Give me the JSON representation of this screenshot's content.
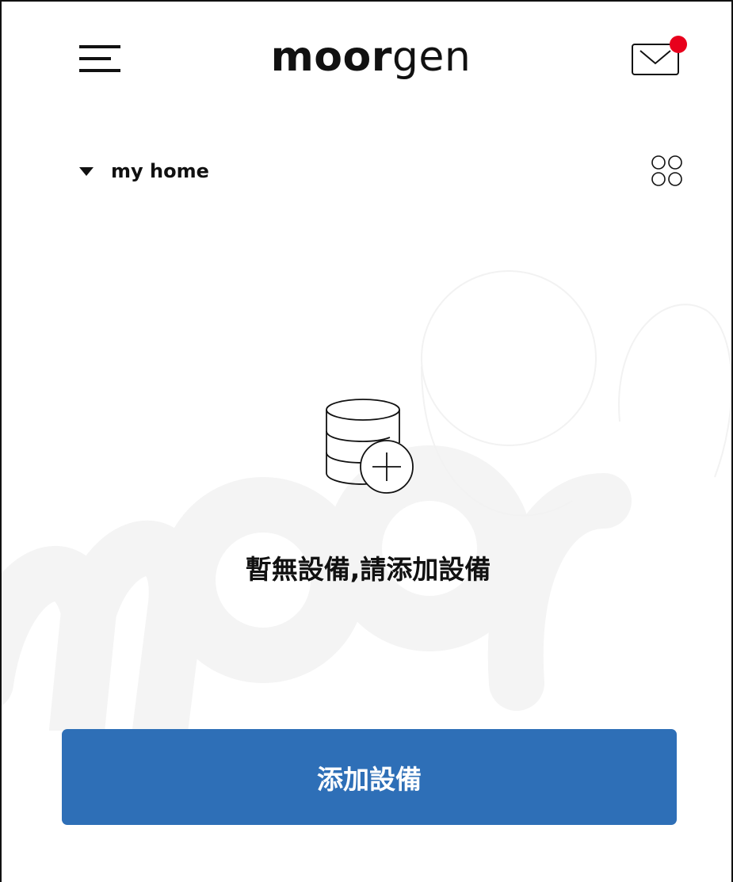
{
  "header": {
    "logo_bold": "moor",
    "logo_light": "gen",
    "menu_icon": "hamburger-menu-icon",
    "mail_icon": "mail-icon",
    "has_unread_notification": true
  },
  "home": {
    "name": "my home",
    "dropdown_icon": "caret-down-icon",
    "layout_icon": "grid-circles-icon"
  },
  "empty_state": {
    "icon": "database-add-icon",
    "message": "暫無設備,請添加設備"
  },
  "actions": {
    "add_device_label": "添加設備"
  },
  "colors": {
    "primary": "#2e6fb7",
    "notification_dot": "#e8001c",
    "text": "#111111",
    "watermark": "#f5f5f5"
  }
}
